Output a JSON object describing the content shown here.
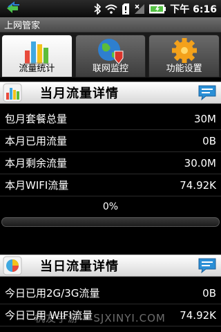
{
  "status_bar": {
    "time": "下午 6:16",
    "icons": [
      "usb-icon",
      "bluetooth-icon",
      "wifi-icon",
      "sd-card-icon",
      "signal-icon",
      "battery-icon"
    ]
  },
  "title": "上网管家",
  "tabs": [
    {
      "label": "流量统计",
      "icon": "bar-chart-icon",
      "active": true
    },
    {
      "label": "联网监控",
      "icon": "globe-shield-icon",
      "active": false
    },
    {
      "label": "功能设置",
      "icon": "gear-icon",
      "active": false
    }
  ],
  "monthly": {
    "title": "当月流量详情",
    "rows": [
      {
        "label": "包月套餐总量",
        "value": "30M"
      },
      {
        "label": "本月已用流量",
        "value": "0B"
      },
      {
        "label": "本月剩余流量",
        "value": "30.0M"
      },
      {
        "label": "本月WIFI流量",
        "value": "74.92K"
      }
    ],
    "percent": "0%",
    "usage_fraction": 0
  },
  "daily": {
    "title": "当日流量详情",
    "rows": [
      {
        "label": "今日已用2G/3G流量",
        "value": "0B"
      },
      {
        "label": "今日已用 WIFI流量",
        "value": "74.92K"
      }
    ]
  },
  "watermark": "机友手游 • SJXINYI.COM",
  "colors": {
    "progress_fill": "#3f9e23",
    "header_bg": "#e6e6e6",
    "accent_blue": "#2a8fd6"
  }
}
